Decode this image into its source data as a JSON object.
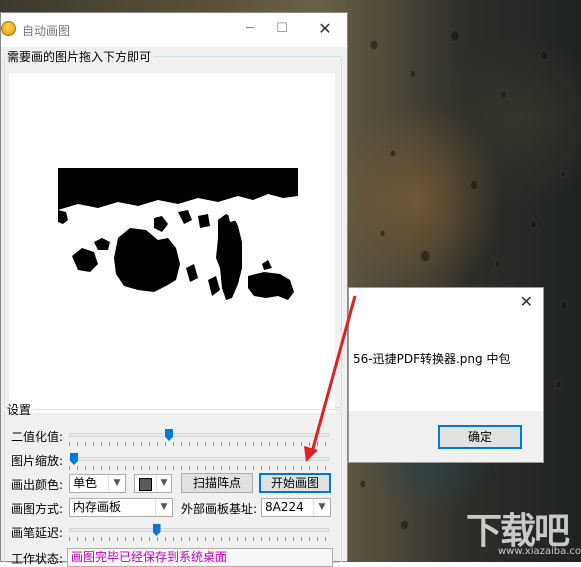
{
  "app": {
    "title": "自动画图",
    "drop_group_label": "需要画的图片拖入下方即可",
    "settings": {
      "group_label": "设置",
      "threshold_label": "二值化值:",
      "threshold_value": 0.38,
      "scale_label": "图片缩放:",
      "scale_value": 0.0,
      "color_label": "画出颜色:",
      "color_mode": "单色",
      "color_swatch": "#5b5b5b",
      "scan_button": "扫描阵点",
      "start_button": "开始画图",
      "draw_mode_label": "画图方式:",
      "draw_mode": "内存画板",
      "external_base_label": "外部画板基址:",
      "external_base_value": "8A224",
      "delay_label": "画笔延迟:",
      "delay_value": 0.33,
      "status_label": "工作状态:",
      "status_text": "画图完毕已经保存到系统桌面"
    }
  },
  "message_box": {
    "message": "56-迅捷PDF转换器.png 中包",
    "ok_button": "确定"
  },
  "watermark": {
    "big": "下载吧",
    "small": "www.xiazaiba.com"
  },
  "colors": {
    "accent": "#0078d7",
    "status_text": "#c000c0",
    "arrow": "#e02020"
  }
}
